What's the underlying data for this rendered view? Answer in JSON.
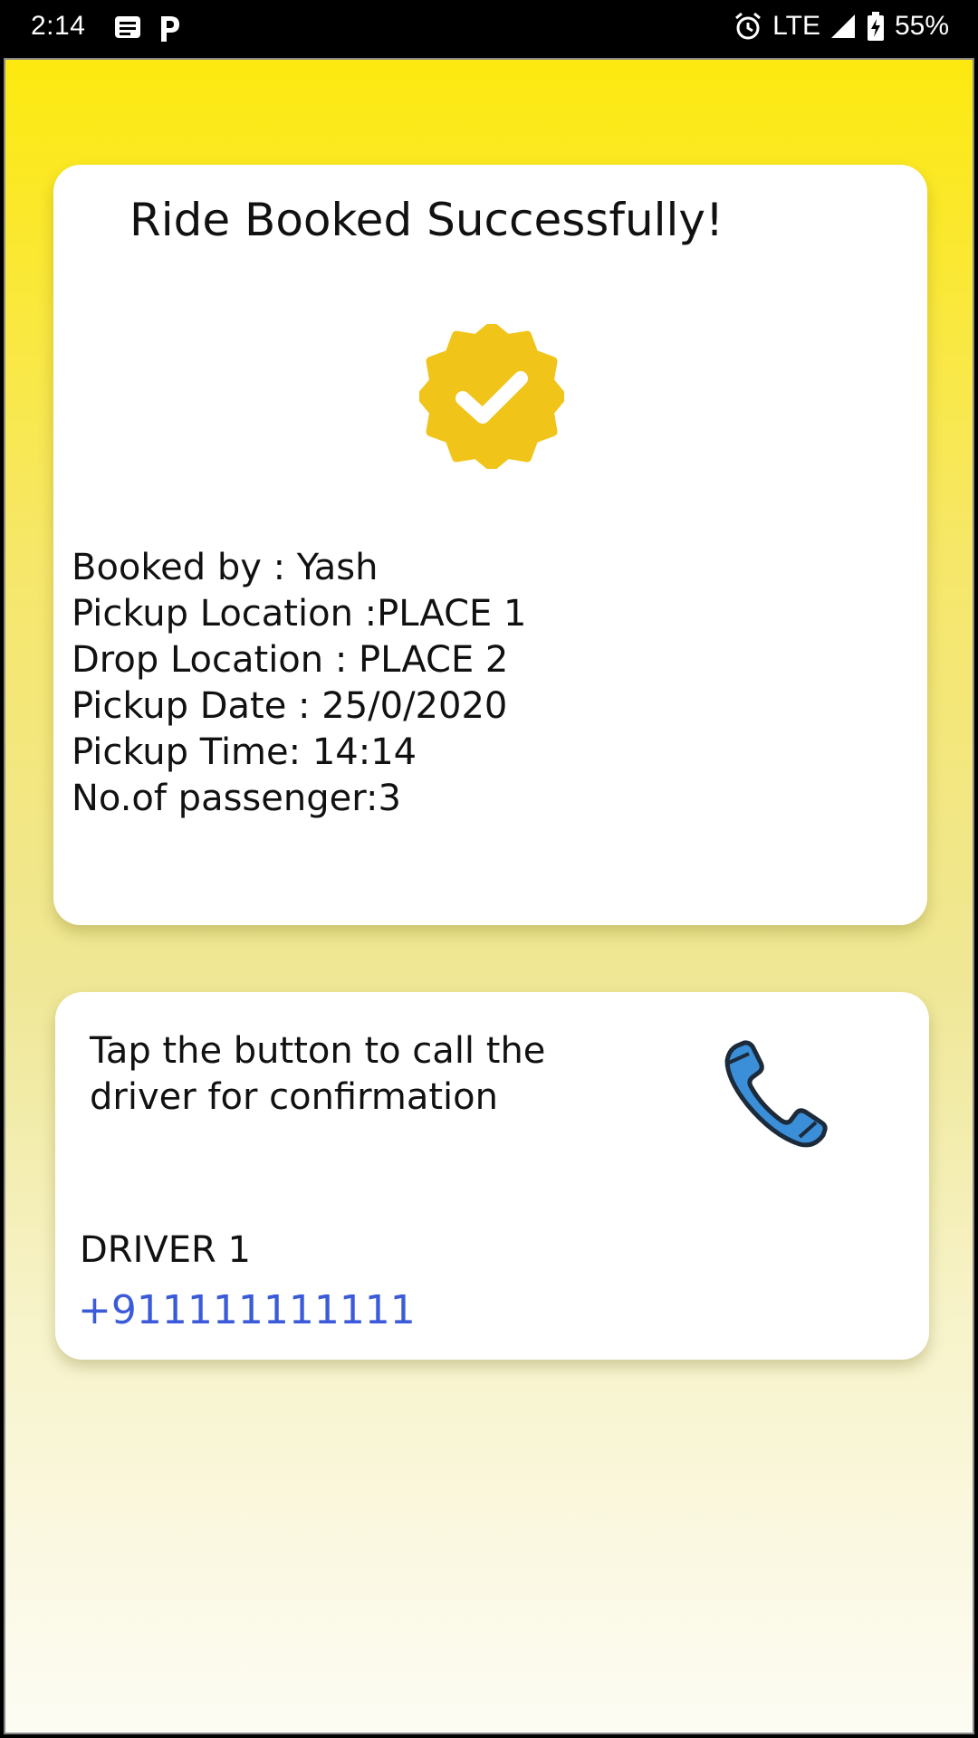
{
  "status_bar": {
    "time": "2:14",
    "left_icons": [
      "message-icon",
      "parking-icon"
    ],
    "network": "LTE",
    "battery": "55%",
    "right_icons": [
      "alarm-icon",
      "signal-icon",
      "battery-icon"
    ]
  },
  "booking": {
    "title": "Ride Booked Successfully!",
    "icon": "verified-badge-icon",
    "details": [
      "Booked by : Yash",
      "Pickup Location :PLACE 1",
      "Drop Location : PLACE 2",
      "Pickup Date : 25/0/2020",
      "Pickup Time: 14:14",
      "No.of passenger:3"
    ]
  },
  "driver": {
    "instruction": "Tap the button to call the driver for confirmation",
    "icon": "phone-icon",
    "name": "DRIVER 1",
    "phone": "+911111111111"
  },
  "colors": {
    "gradient_top": "#fde90f",
    "badge": "#f0c419",
    "phone_icon": "#3a8fd8",
    "link": "#3b5bd8"
  }
}
